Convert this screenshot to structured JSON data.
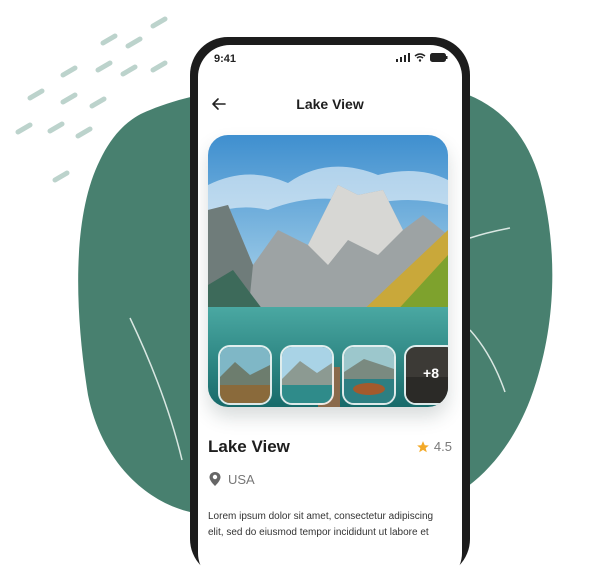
{
  "colors": {
    "blob": "#48806f",
    "accent_star": "#f3a928",
    "text_dark": "#1e1e1e"
  },
  "status": {
    "time": "9:41"
  },
  "header": {
    "title": "Lake View",
    "back_icon": "arrow-left-icon"
  },
  "gallery": {
    "more_count_label": "+8",
    "thumbnails": [
      "thumb-1",
      "thumb-2",
      "thumb-3",
      "thumb-more"
    ]
  },
  "place": {
    "title": "Lake View",
    "rating": "4.5",
    "location": "USA",
    "description": "Lorem ipsum dolor sit amet, consectetur adipiscing elit, sed do eiusmod tempor incididunt ut labore et"
  }
}
